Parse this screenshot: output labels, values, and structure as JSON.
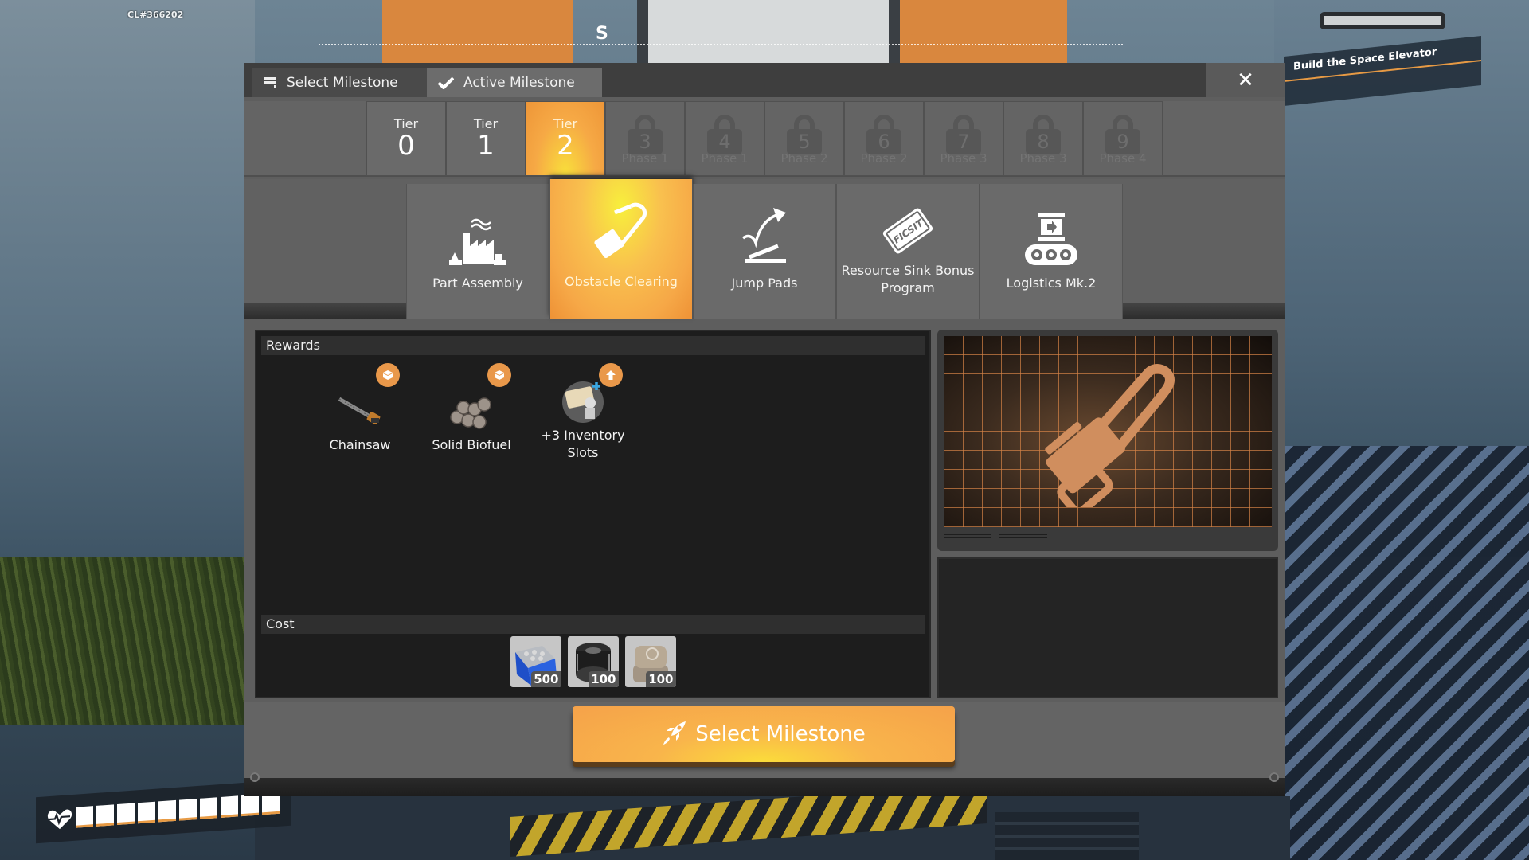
{
  "hud": {
    "build_id": "CL#366202",
    "compass_heading": "S",
    "objective": "Build the Space Elevator",
    "health": {
      "segments_total": 10,
      "segments_filled": 10
    }
  },
  "window": {
    "tabs": [
      {
        "label": "Select Milestone",
        "icon": "milestone-grid-icon",
        "active": false
      },
      {
        "label": "Active Milestone",
        "icon": "checkmark-icon",
        "active": true
      }
    ],
    "close_label": "✕",
    "tiers": [
      {
        "label": "Tier",
        "number": "0",
        "state": "unlocked"
      },
      {
        "label": "Tier",
        "number": "1",
        "state": "unlocked"
      },
      {
        "label": "Tier",
        "number": "2",
        "state": "selected"
      },
      {
        "number": "3",
        "phase": "Phase 1",
        "state": "locked"
      },
      {
        "number": "4",
        "phase": "Phase 1",
        "state": "locked"
      },
      {
        "number": "5",
        "phase": "Phase 2",
        "state": "locked"
      },
      {
        "number": "6",
        "phase": "Phase 2",
        "state": "locked"
      },
      {
        "number": "7",
        "phase": "Phase 3",
        "state": "locked"
      },
      {
        "number": "8",
        "phase": "Phase 3",
        "state": "locked"
      },
      {
        "number": "9",
        "phase": "Phase 4",
        "state": "locked"
      }
    ],
    "milestones": [
      {
        "label": "Part Assembly",
        "icon": "factory-icon",
        "selected": false
      },
      {
        "label": "Obstacle Clearing",
        "icon": "chainsaw-icon",
        "selected": true
      },
      {
        "label": "Jump Pads",
        "icon": "jump-pad-icon",
        "selected": false
      },
      {
        "label": "Resource Sink Bonus Program",
        "icon": "ficsit-coupon-icon",
        "selected": false
      },
      {
        "label": "Logistics Mk.2",
        "icon": "conveyor-icon",
        "selected": false
      }
    ],
    "rewards": {
      "header": "Rewards",
      "items": [
        {
          "label": "Chainsaw",
          "badge": "item-unlock-icon"
        },
        {
          "label": "Solid Biofuel",
          "badge": "item-unlock-icon"
        },
        {
          "label": "+3 Inventory Slots",
          "badge": "upgrade-arrow-icon"
        }
      ]
    },
    "cost": {
      "header": "Cost",
      "items": [
        {
          "name": "Screw",
          "quantity": "500"
        },
        {
          "name": "Wire",
          "quantity": "100"
        },
        {
          "name": "Concrete",
          "quantity": "100"
        }
      ]
    },
    "preview": {
      "subject": "Chainsaw"
    },
    "select_button_label": "Select Milestone",
    "colors": {
      "accent_orange": "#f6a847",
      "accent_yellow": "#f9df3b",
      "panel_gray": "#5e5e5e",
      "panel_dark": "#1d1d1d"
    }
  }
}
